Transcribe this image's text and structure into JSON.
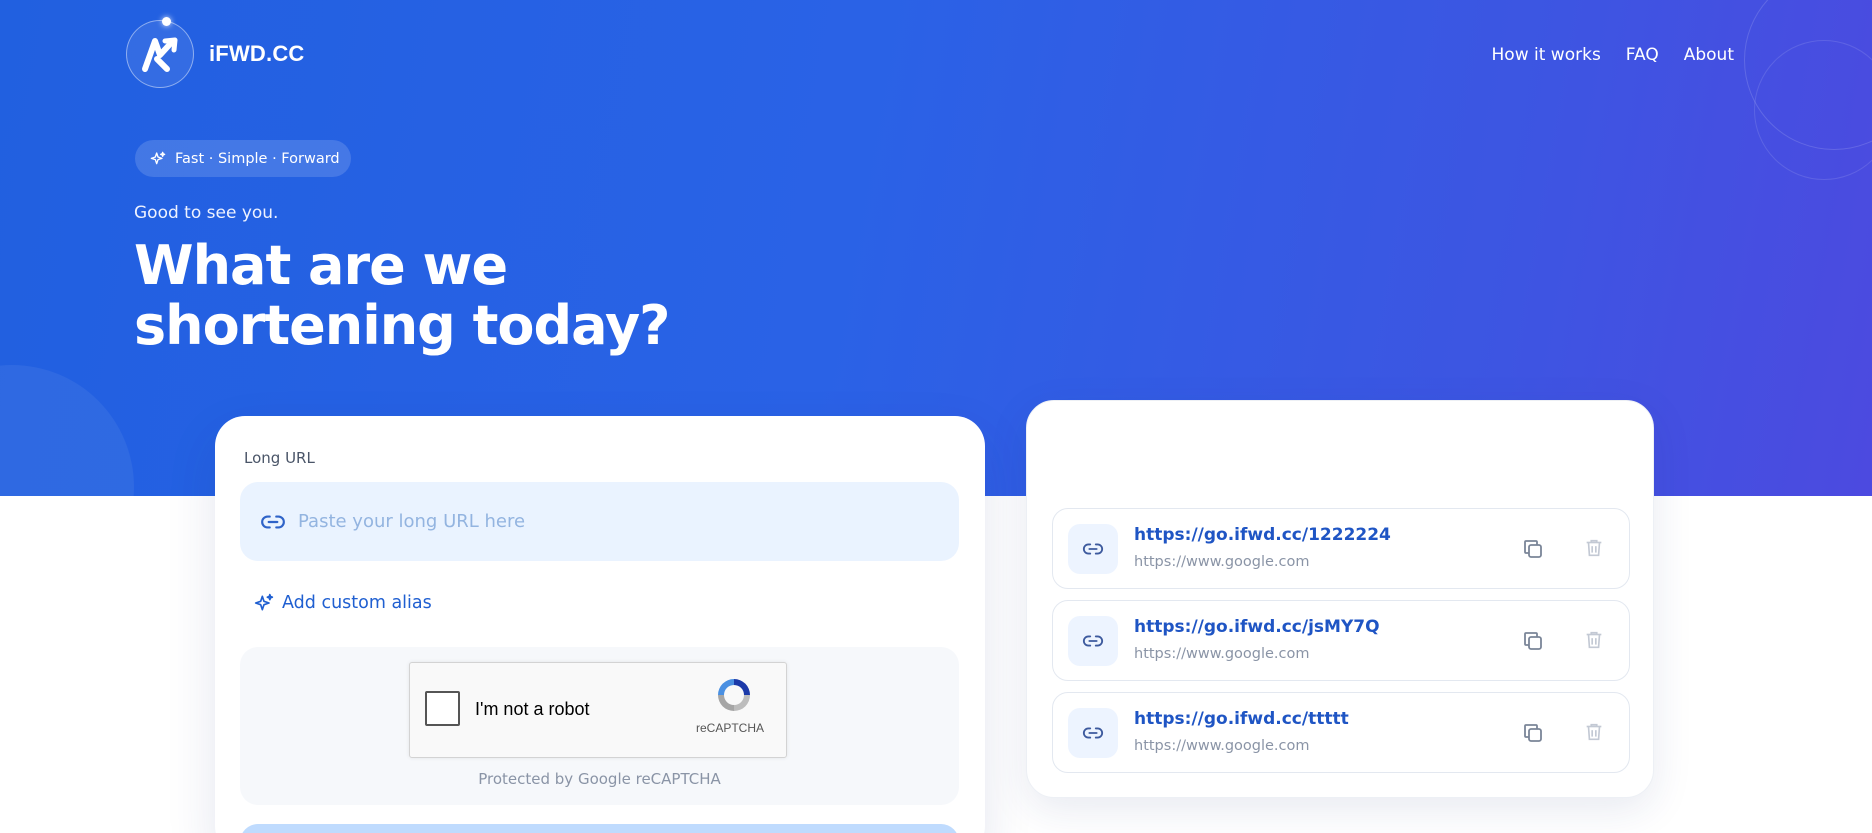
{
  "header": {
    "brand": "iFWD.CC",
    "nav": [
      "How it works",
      "FAQ",
      "About"
    ]
  },
  "hero": {
    "pill": "Fast · Simple · Forward",
    "greeting": "Good to see you.",
    "headline_line1": "What are we",
    "headline_line2": "shortening today?"
  },
  "form": {
    "label": "Long URL",
    "placeholder": "Paste your long URL here",
    "value": "",
    "alias_label": "Add custom alias",
    "captcha_text": "I'm not a robot",
    "captcha_brand": "reCAPTCHA",
    "captcha_note": "Protected by Google reCAPTCHA"
  },
  "history": [
    {
      "short": "https://go.ifwd.cc/1222224",
      "original": "https://www.google.com"
    },
    {
      "short": "https://go.ifwd.cc/jsMY7Q",
      "original": "https://www.google.com"
    },
    {
      "short": "https://go.ifwd.cc/ttttt",
      "original": "https://www.google.com"
    }
  ],
  "icons": {
    "logo": "arrow-logo-icon",
    "pill": "sparkle-icon",
    "input": "link-icon",
    "alias": "sparkle-icon",
    "copy": "copy-icon",
    "delete": "trash-icon"
  },
  "colors": {
    "hero_start": "#2160e0",
    "hero_end": "#4c4ae0",
    "accent": "#1f5fd1",
    "input_bg": "#eaf3ff"
  }
}
